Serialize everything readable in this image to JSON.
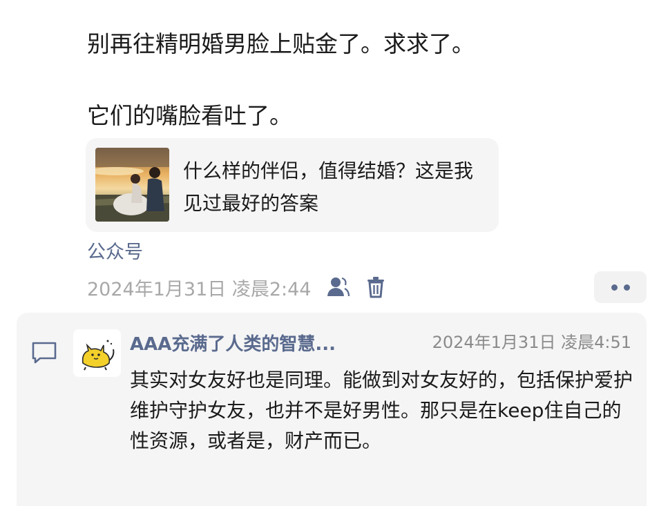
{
  "post": {
    "line1": "别再往精明婚男脸上贴金了。求求了。",
    "line2": "它们的嘴脸看吐了。"
  },
  "link_card": {
    "title": "什么样的伴侣，值得结婚？这是我见过最好的答案"
  },
  "source": {
    "label": "公众号"
  },
  "meta": {
    "timestamp": "2024年1月31日 凌晨2:44",
    "icons": [
      "user-icon",
      "trash-icon"
    ]
  },
  "more_button": {
    "icon": "more-dots-icon"
  },
  "comment": {
    "icon": "comment-icon",
    "avatar_icon": "cat-avatar",
    "author": "AAA充满了人类的智慧...",
    "time": "2024年1月31日 凌晨4:51",
    "text": "其实对女友好也是同理。能做到对女友好的，包括保护爱护维护守护女友，也并不是好男性。那只是在keep住自己的性资源，或者是，财产而已。"
  },
  "colors": {
    "link_blue": "#5a6a8e",
    "panel_gray": "#f5f5f5",
    "timestamp_gray": "#a8a8a8"
  }
}
